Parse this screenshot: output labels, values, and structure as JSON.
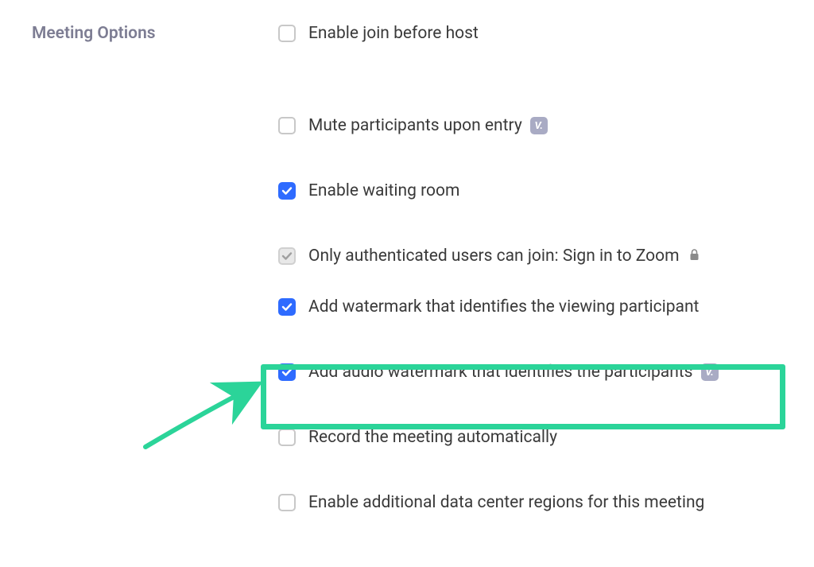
{
  "section": {
    "title": "Meeting Options"
  },
  "options": [
    {
      "label": "Enable join before host",
      "checked": false,
      "disabled": false,
      "badge": false,
      "lock": false
    },
    {
      "label": "Mute participants upon entry",
      "checked": false,
      "disabled": false,
      "badge": true,
      "lock": false
    },
    {
      "label": "Enable waiting room",
      "checked": true,
      "disabled": false,
      "badge": false,
      "lock": false
    },
    {
      "label": "Only authenticated users can join: Sign in to Zoom",
      "checked": true,
      "disabled": true,
      "badge": false,
      "lock": true
    },
    {
      "label": "Add watermark that identifies the viewing participant",
      "checked": true,
      "disabled": false,
      "badge": false,
      "lock": false
    },
    {
      "label": "Add audio watermark that identifies the participants",
      "checked": true,
      "disabled": false,
      "badge": true,
      "lock": false
    },
    {
      "label": "Record the meeting automatically",
      "checked": false,
      "disabled": false,
      "badge": false,
      "lock": false
    },
    {
      "label": "Enable additional data center regions for this meeting",
      "checked": false,
      "disabled": false,
      "badge": false,
      "lock": false
    }
  ],
  "annotation": {
    "highlight_color": "#2bd499",
    "arrow_color": "#2bd499"
  }
}
